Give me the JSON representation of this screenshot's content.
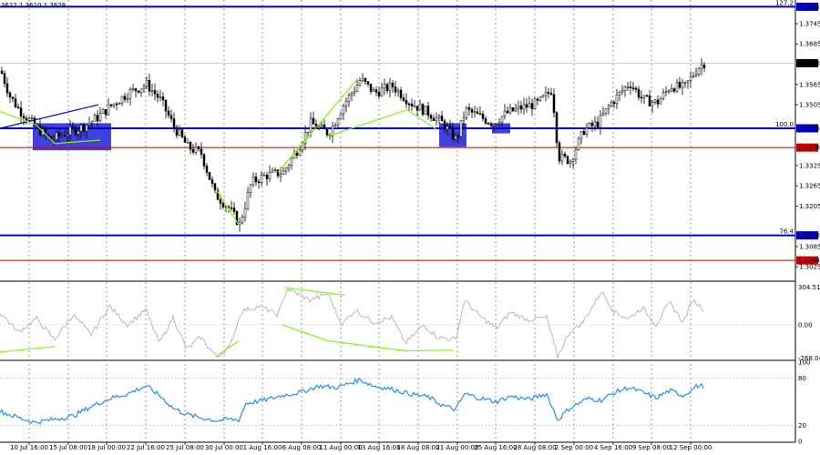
{
  "header": {
    "ohlc": "3622 1.3610 1.3628"
  },
  "colors": {
    "bull_candle": "#000000",
    "bear_candle": "#000000",
    "support_line": "#0000cc",
    "red_line": "#cc0000",
    "box_fill": "#1f1fd6",
    "trend_green": "#7cfc00",
    "cci_line": "#b8b8b8",
    "rsi_line": "#1e90ff",
    "grid": "#000000",
    "label_bg": "#000000"
  },
  "chart_data": [
    {
      "type": "candlestick",
      "title": "",
      "y_range": [
        1.2985,
        1.3815
      ],
      "y_ticks": [
        "1.3745",
        "1.3685",
        "1.3565",
        "1.3505",
        "1.3325",
        "1.3265",
        "1.3205",
        "1.3085",
        "1.3025"
      ],
      "price_labels": [
        {
          "value": 1.3795,
          "text": "1.3795",
          "color": "#0000cc"
        },
        {
          "value": 1.3628,
          "text": "1.3628",
          "color": "#000000"
        },
        {
          "value": 1.3435,
          "text": "1.3435",
          "color": "#0000cc"
        },
        {
          "value": 1.3378,
          "text": "1.3378",
          "color": "#cc0000"
        },
        {
          "value": 1.3118,
          "text": "1.3118",
          "color": "#0000cc"
        },
        {
          "value": 1.3044,
          "text": "1.3044",
          "color": "#cc0000"
        }
      ],
      "horizontal_levels": [
        {
          "value": 1.3795,
          "label": "127.2",
          "color": "#0000cc",
          "width": 2
        },
        {
          "value": 1.3435,
          "label": "100.0",
          "color": "#0000cc",
          "width": 2
        },
        {
          "value": 1.3378,
          "label": "",
          "color": "#cc0000",
          "width": 1
        },
        {
          "value": 1.3118,
          "label": "76.4",
          "color": "#0000cc",
          "width": 2
        },
        {
          "value": 1.3044,
          "label": "",
          "color": "#cc0000",
          "width": 1
        }
      ],
      "anchors": [
        [
          0,
          1.3605
        ],
        [
          10,
          1.353
        ],
        [
          20,
          1.349
        ],
        [
          38,
          1.344
        ],
        [
          55,
          1.34
        ],
        [
          70,
          1.342
        ],
        [
          90,
          1.344
        ],
        [
          105,
          1.3465
        ],
        [
          120,
          1.35
        ],
        [
          140,
          1.354
        ],
        [
          160,
          1.3565
        ],
        [
          175,
          1.352
        ],
        [
          190,
          1.344
        ],
        [
          205,
          1.338
        ],
        [
          220,
          1.336
        ],
        [
          235,
          1.324
        ],
        [
          250,
          1.32
        ],
        [
          262,
          1.315
        ],
        [
          275,
          1.3275
        ],
        [
          290,
          1.3295
        ],
        [
          310,
          1.3305
        ],
        [
          325,
          1.337
        ],
        [
          340,
          1.345
        ],
        [
          360,
          1.342
        ],
        [
          375,
          1.35
        ],
        [
          395,
          1.358
        ],
        [
          410,
          1.354
        ],
        [
          430,
          1.356
        ],
        [
          450,
          1.351
        ],
        [
          470,
          1.348
        ],
        [
          485,
          1.345
        ],
        [
          500,
          1.34
        ],
        [
          510,
          1.349
        ],
        [
          525,
          1.347
        ],
        [
          540,
          1.345
        ],
        [
          555,
          1.348
        ],
        [
          570,
          1.3495
        ],
        [
          590,
          1.351
        ],
        [
          605,
          1.355
        ],
        [
          612,
          1.335
        ],
        [
          625,
          1.334
        ],
        [
          640,
          1.343
        ],
        [
          655,
          1.345
        ],
        [
          670,
          1.351
        ],
        [
          690,
          1.357
        ],
        [
          705,
          1.352
        ],
        [
          720,
          1.351
        ],
        [
          735,
          1.356
        ],
        [
          750,
          1.3555
        ],
        [
          765,
          1.3615
        ],
        [
          772,
          1.3628
        ]
      ],
      "x_ticks": [
        "10 Jul 16:00",
        "15 Jul 08:00",
        "18 Jul 00:00",
        "22 Jul 16:00",
        "25 Jul 08:00",
        "30 Jul 00:00",
        "1 Aug 16:00",
        "6 Aug 08:00",
        "11 Aug 00:00",
        "13 Aug 16:00",
        "18 Aug 08:00",
        "21 Aug 00:00",
        "25 Aug 16:00",
        "28 Aug 08:00",
        "2 Sep 00:00",
        "4 Sep 16:00",
        "9 Sep 08:00",
        "12 Sep 00:00"
      ],
      "zones": [
        {
          "x_from": 36,
          "x_to": 122,
          "y_from": 1.345,
          "y_to": 1.337
        },
        {
          "x_from": 482,
          "x_to": 512,
          "y_from": 1.345,
          "y_to": 1.338
        },
        {
          "x_from": 540,
          "x_to": 560,
          "y_from": 1.345,
          "y_to": 1.342
        }
      ],
      "trendlines": [
        {
          "points": [
            [
              0,
              1.3435
            ],
            [
              108,
              1.3505
            ]
          ],
          "color": "#0000cc"
        },
        {
          "points": [
            [
              0,
              1.3485
            ],
            [
              40,
              1.3445
            ],
            [
              60,
              1.339
            ],
            [
              110,
              1.34
            ]
          ],
          "color": "#7cfc00"
        },
        {
          "points": [
            [
              237,
              1.3255
            ],
            [
              262,
              1.315
            ]
          ],
          "color": "#7cfc00"
        },
        {
          "points": [
            [
              305,
              1.3305
            ],
            [
              392,
              1.358
            ]
          ],
          "color": "#7cfc00"
        },
        {
          "points": [
            [
              358,
              1.341
            ],
            [
              447,
              1.349
            ],
            [
              480,
              1.343
            ]
          ],
          "color": "#7cfc00"
        }
      ]
    },
    {
      "type": "line",
      "title": "",
      "y_range": [
        -280,
        330
      ],
      "y_ticks": [
        "304.5101",
        "0.00",
        "-268.0444"
      ],
      "level_labels": [
        {
          "value": 304.5101,
          "text": "304.5101"
        },
        {
          "value": 0,
          "text": "0.00"
        },
        {
          "value": -268.0444,
          "text": "-268.0444"
        }
      ],
      "anchors": [
        [
          0,
          100
        ],
        [
          20,
          -60
        ],
        [
          40,
          50
        ],
        [
          60,
          -120
        ],
        [
          80,
          80
        ],
        [
          100,
          -80
        ],
        [
          120,
          150
        ],
        [
          140,
          0
        ],
        [
          160,
          120
        ],
        [
          175,
          -150
        ],
        [
          190,
          60
        ],
        [
          205,
          -200
        ],
        [
          220,
          -100
        ],
        [
          238,
          -260
        ],
        [
          252,
          -180
        ],
        [
          265,
          110
        ],
        [
          285,
          150
        ],
        [
          305,
          80
        ],
        [
          315,
          290
        ],
        [
          340,
          200
        ],
        [
          360,
          250
        ],
        [
          375,
          0
        ],
        [
          390,
          120
        ],
        [
          410,
          20
        ],
        [
          430,
          60
        ],
        [
          445,
          -150
        ],
        [
          465,
          0
        ],
        [
          480,
          -100
        ],
        [
          500,
          -120
        ],
        [
          510,
          200
        ],
        [
          525,
          80
        ],
        [
          545,
          -30
        ],
        [
          560,
          100
        ],
        [
          580,
          40
        ],
        [
          600,
          60
        ],
        [
          612,
          -260
        ],
        [
          625,
          -60
        ],
        [
          640,
          20
        ],
        [
          660,
          270
        ],
        [
          675,
          100
        ],
        [
          690,
          50
        ],
        [
          705,
          140
        ],
        [
          720,
          0
        ],
        [
          735,
          180
        ],
        [
          750,
          20
        ],
        [
          760,
          200
        ],
        [
          772,
          130
        ]
      ],
      "trendlines": [
        {
          "points": [
            [
              0,
              -220
            ],
            [
              60,
              -175
            ]
          ],
          "color": "#7cfc00"
        },
        {
          "points": [
            [
              237,
              -255
            ],
            [
              262,
              -130
            ]
          ],
          "color": "#7cfc00"
        },
        {
          "points": [
            [
              313,
              300
            ],
            [
              378,
              240
            ]
          ],
          "color": "#7cfc00"
        },
        {
          "points": [
            [
              310,
              0
            ],
            [
              360,
              -130
            ],
            [
              445,
              -210
            ],
            [
              497,
              -205
            ]
          ],
          "color": "#7cfc00"
        }
      ]
    },
    {
      "type": "line",
      "title": "",
      "y_range": [
        0,
        100
      ],
      "y_ticks": [
        "100",
        "80",
        "20",
        "0"
      ],
      "level_labels": [
        {
          "value": 100,
          "text": "100"
        },
        {
          "value": 80,
          "text": "80"
        },
        {
          "value": 20,
          "text": "20"
        },
        {
          "value": 0,
          "text": "0"
        }
      ],
      "guide_levels": [
        80,
        20
      ],
      "anchors": [
        [
          0,
          38
        ],
        [
          20,
          30
        ],
        [
          38,
          24
        ],
        [
          60,
          28
        ],
        [
          80,
          32
        ],
        [
          100,
          44
        ],
        [
          120,
          54
        ],
        [
          140,
          60
        ],
        [
          160,
          70
        ],
        [
          175,
          58
        ],
        [
          190,
          42
        ],
        [
          205,
          34
        ],
        [
          220,
          30
        ],
        [
          238,
          26
        ],
        [
          252,
          28
        ],
        [
          262,
          27
        ],
        [
          270,
          48
        ],
        [
          290,
          52
        ],
        [
          310,
          58
        ],
        [
          330,
          62
        ],
        [
          350,
          70
        ],
        [
          370,
          68
        ],
        [
          395,
          78
        ],
        [
          410,
          70
        ],
        [
          430,
          66
        ],
        [
          450,
          60
        ],
        [
          470,
          56
        ],
        [
          485,
          46
        ],
        [
          500,
          40
        ],
        [
          510,
          60
        ],
        [
          525,
          55
        ],
        [
          545,
          50
        ],
        [
          560,
          57
        ],
        [
          580,
          53
        ],
        [
          600,
          60
        ],
        [
          612,
          27
        ],
        [
          625,
          42
        ],
        [
          645,
          54
        ],
        [
          660,
          52
        ],
        [
          675,
          62
        ],
        [
          690,
          68
        ],
        [
          705,
          62
        ],
        [
          720,
          55
        ],
        [
          735,
          64
        ],
        [
          750,
          58
        ],
        [
          765,
          70
        ],
        [
          772,
          70
        ]
      ]
    }
  ]
}
